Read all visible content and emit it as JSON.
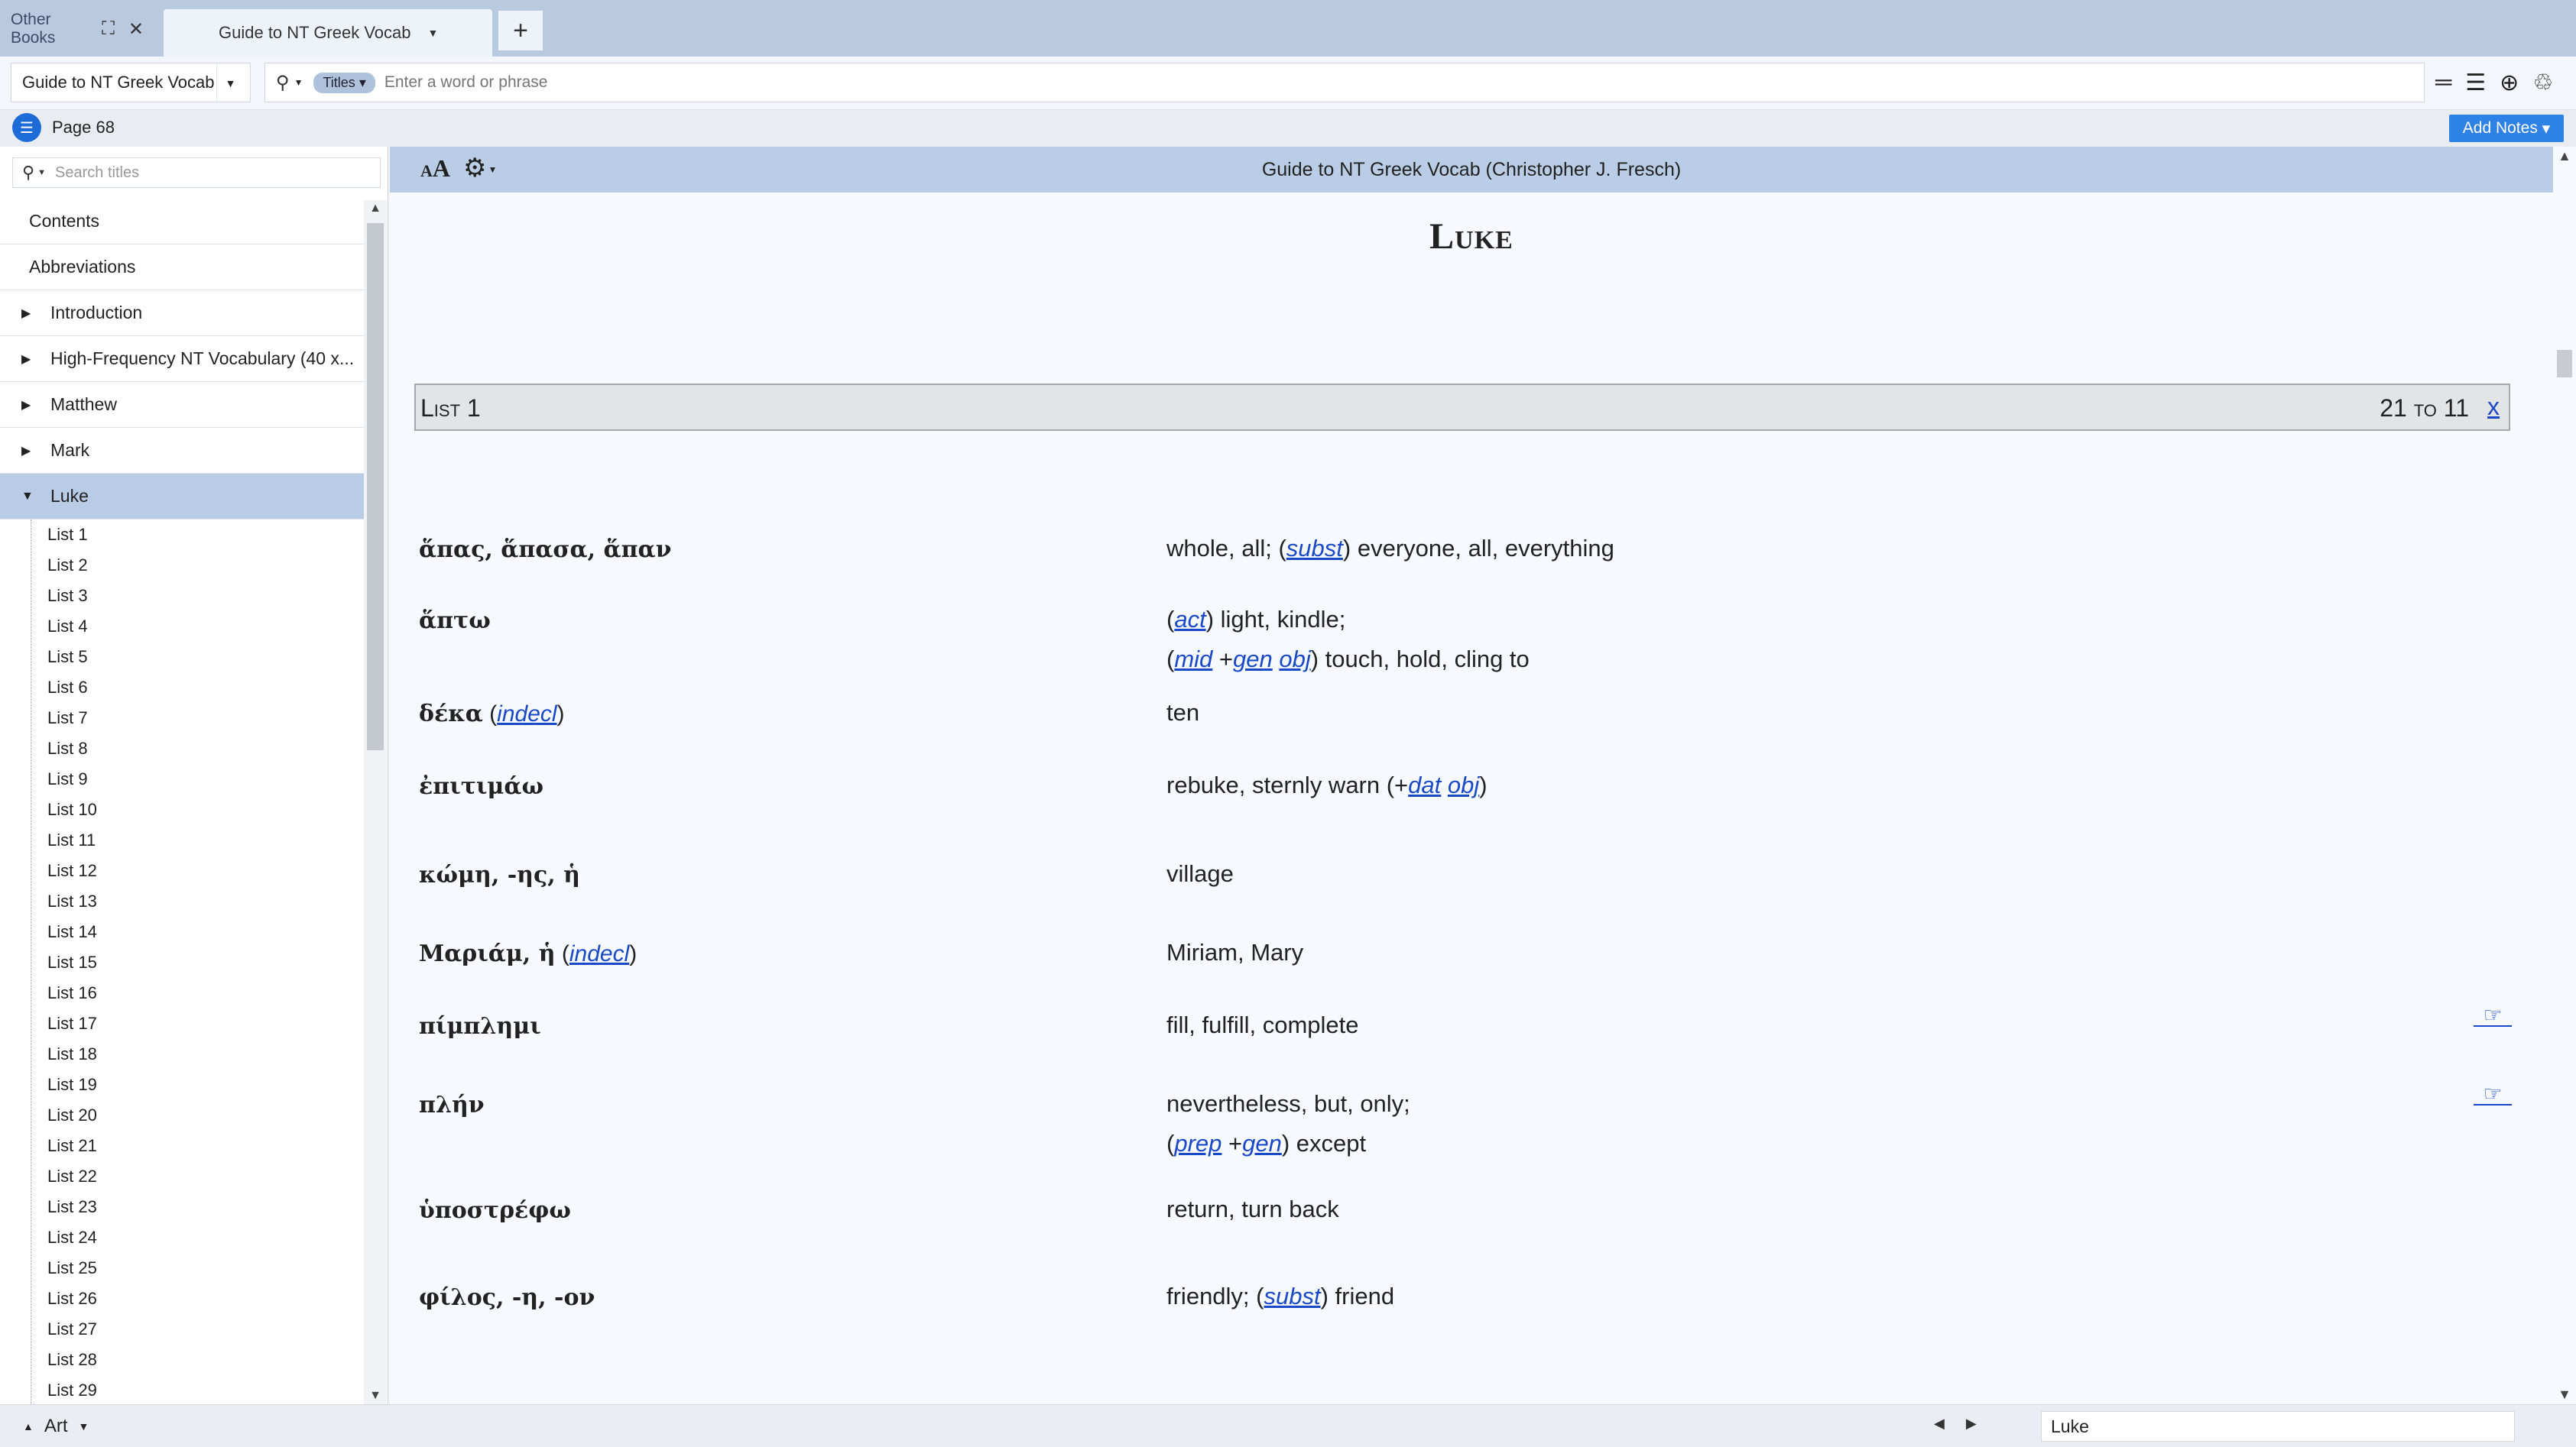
{
  "tabs": {
    "other_books": "Other Books",
    "active": "Guide to NT Greek Vocab",
    "add": "+"
  },
  "search": {
    "resource": "Guide to NT Greek Vocab",
    "scope": "Titles",
    "placeholder": "Enter a word or phrase"
  },
  "page": {
    "label": "Page 68",
    "add_notes": "Add Notes"
  },
  "sidebar": {
    "search_placeholder": "Search titles",
    "items": [
      {
        "label": "Contents",
        "expander": ""
      },
      {
        "label": "Abbreviations",
        "expander": ""
      },
      {
        "label": "Introduction",
        "expander": "collapsed"
      },
      {
        "label": "High-Frequency NT Vocabulary (40 x...",
        "expander": "collapsed"
      },
      {
        "label": "Matthew",
        "expander": "collapsed"
      },
      {
        "label": "Mark",
        "expander": "collapsed"
      },
      {
        "label": "Luke",
        "expander": "expanded",
        "selected": true
      }
    ],
    "sub_items": [
      "List 1",
      "List 2",
      "List 3",
      "List 4",
      "List 5",
      "List 6",
      "List 7",
      "List 8",
      "List 9",
      "List 10",
      "List 11",
      "List 12",
      "List 13",
      "List 14",
      "List 15",
      "List 16",
      "List 17",
      "List 18",
      "List 19",
      "List 20",
      "List 21",
      "List 22",
      "List 23",
      "List 24",
      "List 25",
      "List 26",
      "List 27",
      "List 28",
      "List 29"
    ]
  },
  "content": {
    "book_title": "Guide to NT Greek Vocab (Christopher J. Fresch)",
    "font_size_small": "A",
    "font_size_big": "A",
    "chapter_title": "Luke",
    "list_title": "List 1",
    "list_range": "21 to 11",
    "list_close": "x",
    "entries": [
      {
        "greek": "ἅπας, ἅπασα, ἅπαν",
        "g_abbr": "",
        "gloss": [
          [
            "whole, all; (",
            "subst",
            ") everyone, all, everything"
          ]
        ]
      },
      {
        "greek": "ἅπτω",
        "g_abbr": "",
        "gloss": [
          [
            "(",
            "act",
            ") light, kindle;"
          ],
          [
            "(",
            "mid",
            " +",
            "gen",
            " ",
            "obj",
            ") touch, hold, cling to"
          ]
        ]
      },
      {
        "greek": "δέκα",
        "g_abbr": "indecl",
        "gloss": [
          [
            "ten"
          ]
        ]
      },
      {
        "greek": "ἐπιτιμάω",
        "g_abbr": "",
        "gloss": [
          [
            "rebuke, sternly warn (+",
            "dat",
            " ",
            "obj",
            ")"
          ]
        ]
      },
      {
        "greek": "κώμη, -ης, ἡ",
        "g_abbr": "",
        "gloss": [
          [
            "village"
          ]
        ]
      },
      {
        "greek": "Μαριάμ, ἡ",
        "g_abbr": "indecl",
        "gloss": [
          [
            "Miriam, Mary"
          ]
        ]
      },
      {
        "greek": "πίμπλημι",
        "g_abbr": "",
        "gloss": [
          [
            "fill, fulfill, complete"
          ]
        ],
        "note": true
      },
      {
        "greek": "πλήν",
        "g_abbr": "",
        "gloss": [
          [
            "nevertheless, but, only;"
          ],
          [
            "(",
            "prep",
            " +",
            "gen",
            ") except"
          ]
        ],
        "note": true
      },
      {
        "greek": "ὑποστρέφω",
        "g_abbr": "",
        "gloss": [
          [
            "return, turn back"
          ]
        ]
      },
      {
        "greek": "φίλος, -η, -ον",
        "g_abbr": "",
        "gloss": [
          [
            "friendly; (",
            "subst",
            ") friend"
          ]
        ]
      }
    ]
  },
  "status": {
    "left_label": "Art",
    "location": "Luke"
  },
  "colors": {
    "tabbar": "#b9c9e0",
    "accent": "#2e82e6",
    "link": "#1a49c8",
    "selection": "#b9cce6"
  }
}
